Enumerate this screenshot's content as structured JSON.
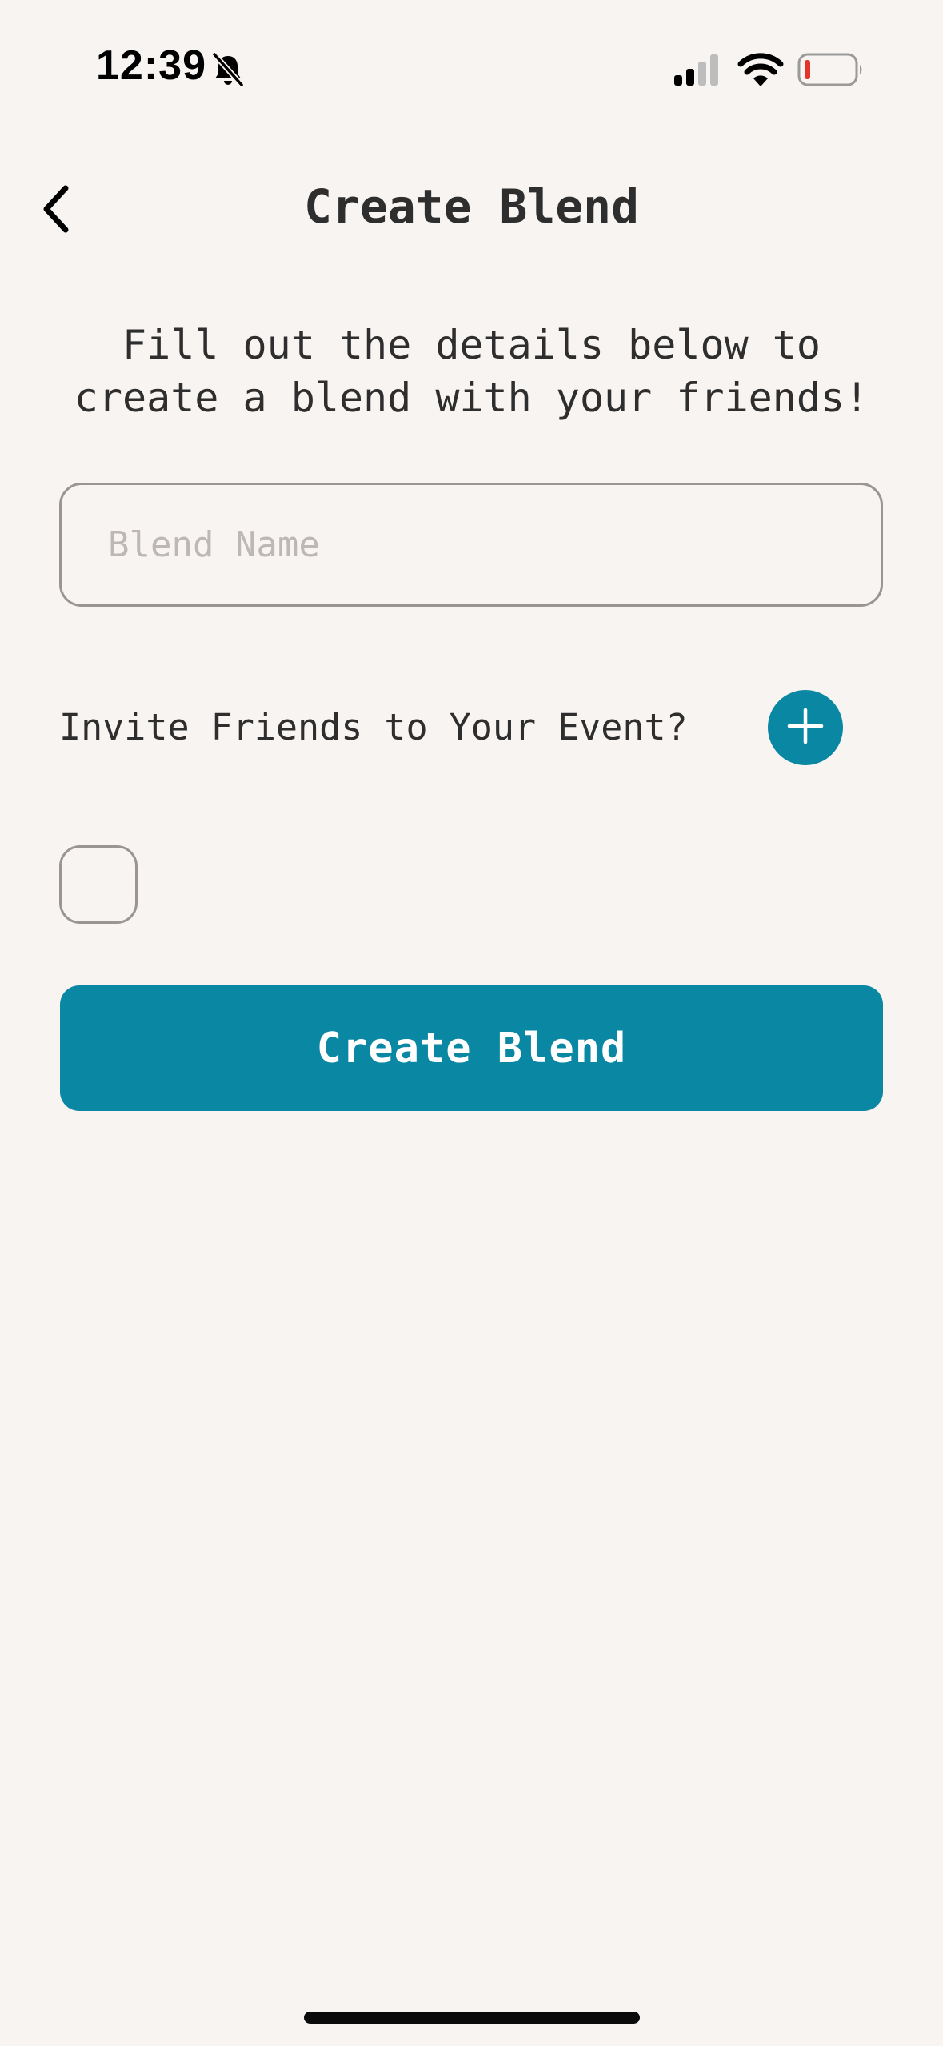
{
  "status_bar": {
    "time": "12:39",
    "icons": [
      "bell-slash-icon",
      "cellular-signal-icon",
      "wifi-icon",
      "battery-low-icon"
    ]
  },
  "nav": {
    "back_icon": "chevron-left-icon",
    "title": "Create Blend"
  },
  "intro": {
    "text": "Fill out the details below to\ncreate a blend with your friends!"
  },
  "form": {
    "blend_name": {
      "value": "",
      "placeholder": "Blend Name"
    },
    "invite_label": "Invite Friends to Your Event?",
    "add_friend_icon": "plus-icon",
    "submit_label": "Create Blend"
  },
  "colors": {
    "background": "#f7f4f1",
    "accent": "#0a87a2",
    "text": "#2e2e2e",
    "border": "#9a9594",
    "placeholder": "#bdb8b6",
    "battery_low": "#e5352b"
  }
}
